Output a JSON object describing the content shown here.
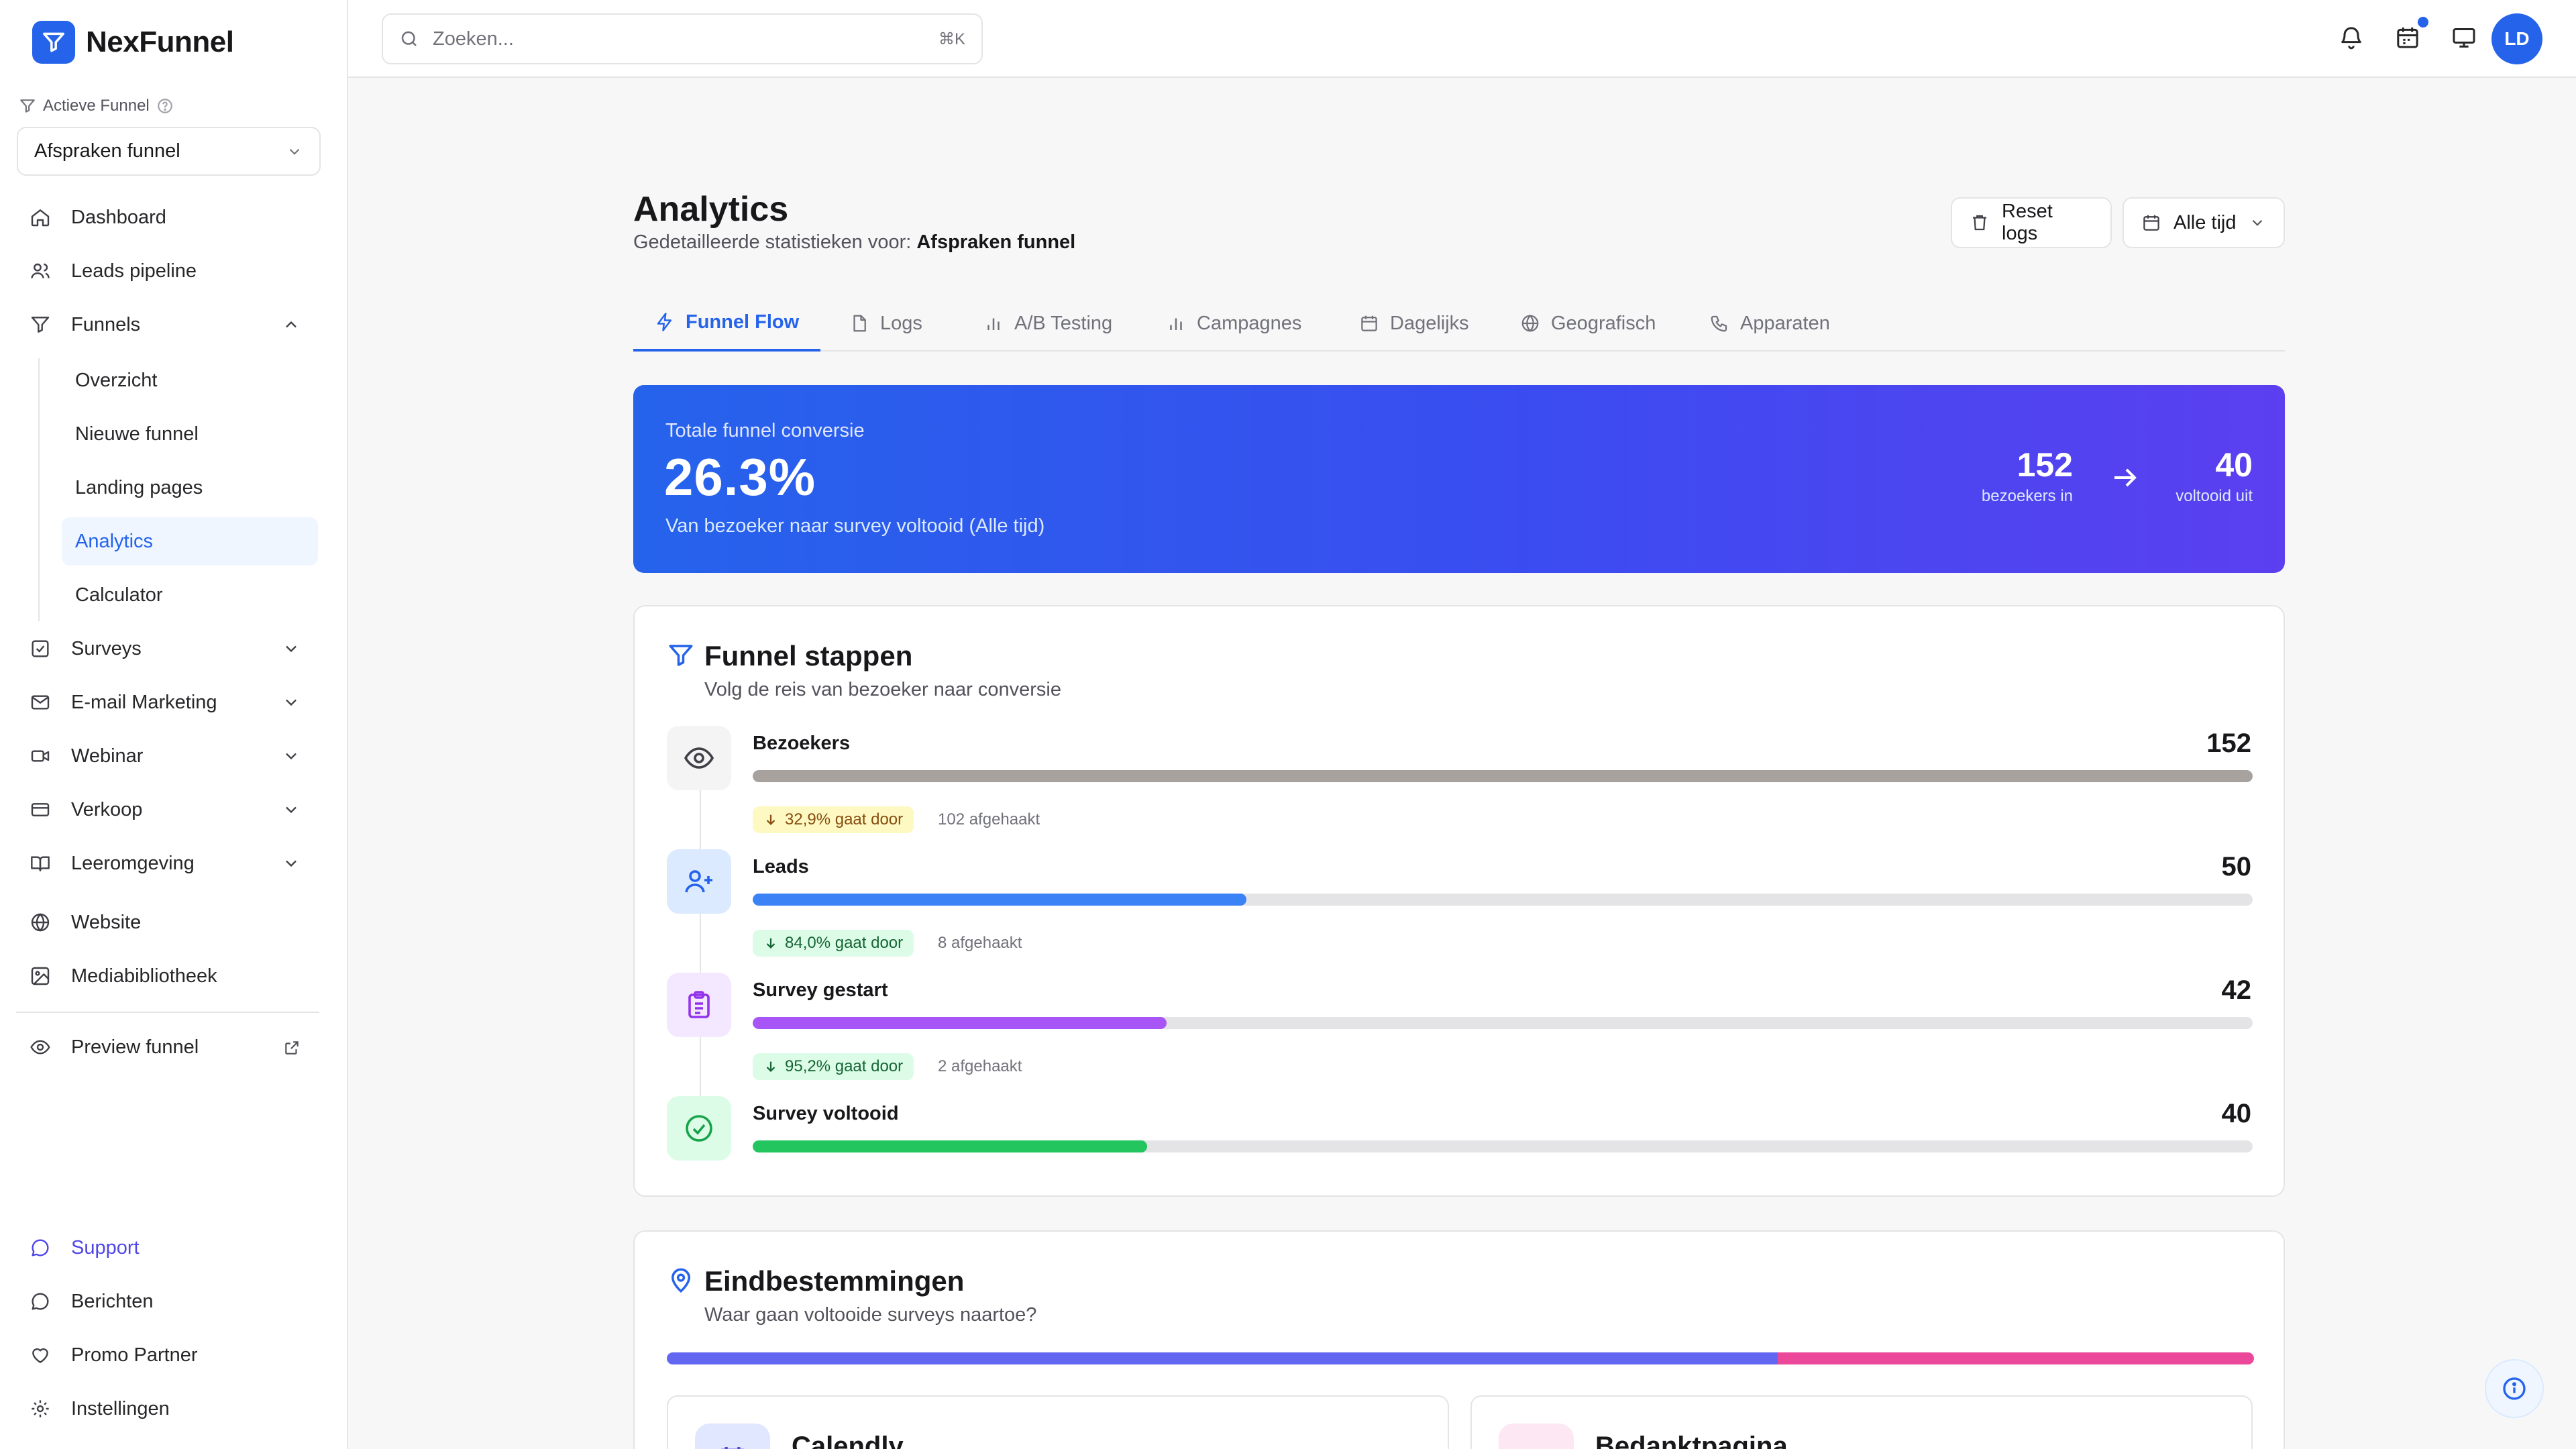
{
  "app": {
    "name": "NexFunnel"
  },
  "sidebar": {
    "active_funnel_label": "Actieve Funnel",
    "selected_funnel": "Afspraken funnel",
    "items": {
      "dashboard": "Dashboard",
      "leads": "Leads pipeline",
      "funnels": "Funnels",
      "surveys": "Surveys",
      "email": "E-mail Marketing",
      "webinar": "Webinar",
      "verkoop": "Verkoop",
      "leeromgeving": "Leeromgeving",
      "website": "Website",
      "media": "Mediabibliotheek",
      "preview": "Preview funnel",
      "support": "Support",
      "berichten": "Berichten",
      "promo": "Promo Partner",
      "instellingen": "Instellingen"
    },
    "funnel_sub": {
      "overzicht": "Overzicht",
      "nieuwe": "Nieuwe funnel",
      "landing": "Landing pages",
      "analytics": "Analytics",
      "calculator": "Calculator"
    }
  },
  "topbar": {
    "search_placeholder": "Zoeken...",
    "search_shortcut": "⌘K",
    "avatar_initials": "LD"
  },
  "page": {
    "title": "Analytics",
    "subtitle_prefix": "Gedetailleerde statistieken voor:",
    "subtitle_funnel": "Afspraken funnel",
    "reset_label": "Reset logs",
    "range_label": "Alle tijd"
  },
  "tabs": {
    "flow": "Funnel Flow",
    "logs": "Logs",
    "ab": "A/B Testing",
    "campagnes": "Campagnes",
    "dagelijks": "Dagelijks",
    "geo": "Geografisch",
    "apparaten": "Apparaten"
  },
  "hero": {
    "label": "Totale funnel conversie",
    "value": "26.3%",
    "note": "Van bezoeker naar survey voltooid (Alle tijd)",
    "in_value": "152",
    "in_label": "bezoekers in",
    "out_value": "40",
    "out_label": "voltooid uit"
  },
  "funnel_steps": {
    "title": "Funnel stappen",
    "subtitle": "Volg de reis van bezoeker naar conversie",
    "steps": [
      {
        "name": "Bezoekers",
        "count": "152",
        "fraction": 1.0,
        "color": "#a8a29e"
      },
      {
        "name": "Leads",
        "count": "50",
        "fraction": 0.329,
        "color": "#3b82f6"
      },
      {
        "name": "Survey gestart",
        "count": "42",
        "fraction": 0.276,
        "color": "#a855f7"
      },
      {
        "name": "Survey voltooid",
        "count": "40",
        "fraction": 0.263,
        "color": "#22c55e"
      }
    ],
    "transitions": [
      {
        "pass": "32,9% gaat door",
        "drop": "102 afgehaakt"
      },
      {
        "pass": "84,0% gaat door",
        "drop": "8 afgehaakt"
      },
      {
        "pass": "95,2% gaat door",
        "drop": "2 afgehaakt"
      }
    ]
  },
  "destinations": {
    "title": "Eindbestemmingen",
    "subtitle": "Waar gaan voltooide surveys naartoe?",
    "split": [
      0.7,
      0.3
    ],
    "colors": [
      "#6366f1",
      "#ec4899"
    ],
    "items": [
      {
        "name": "Calendly"
      },
      {
        "name": "Bedanktpagina"
      }
    ]
  }
}
